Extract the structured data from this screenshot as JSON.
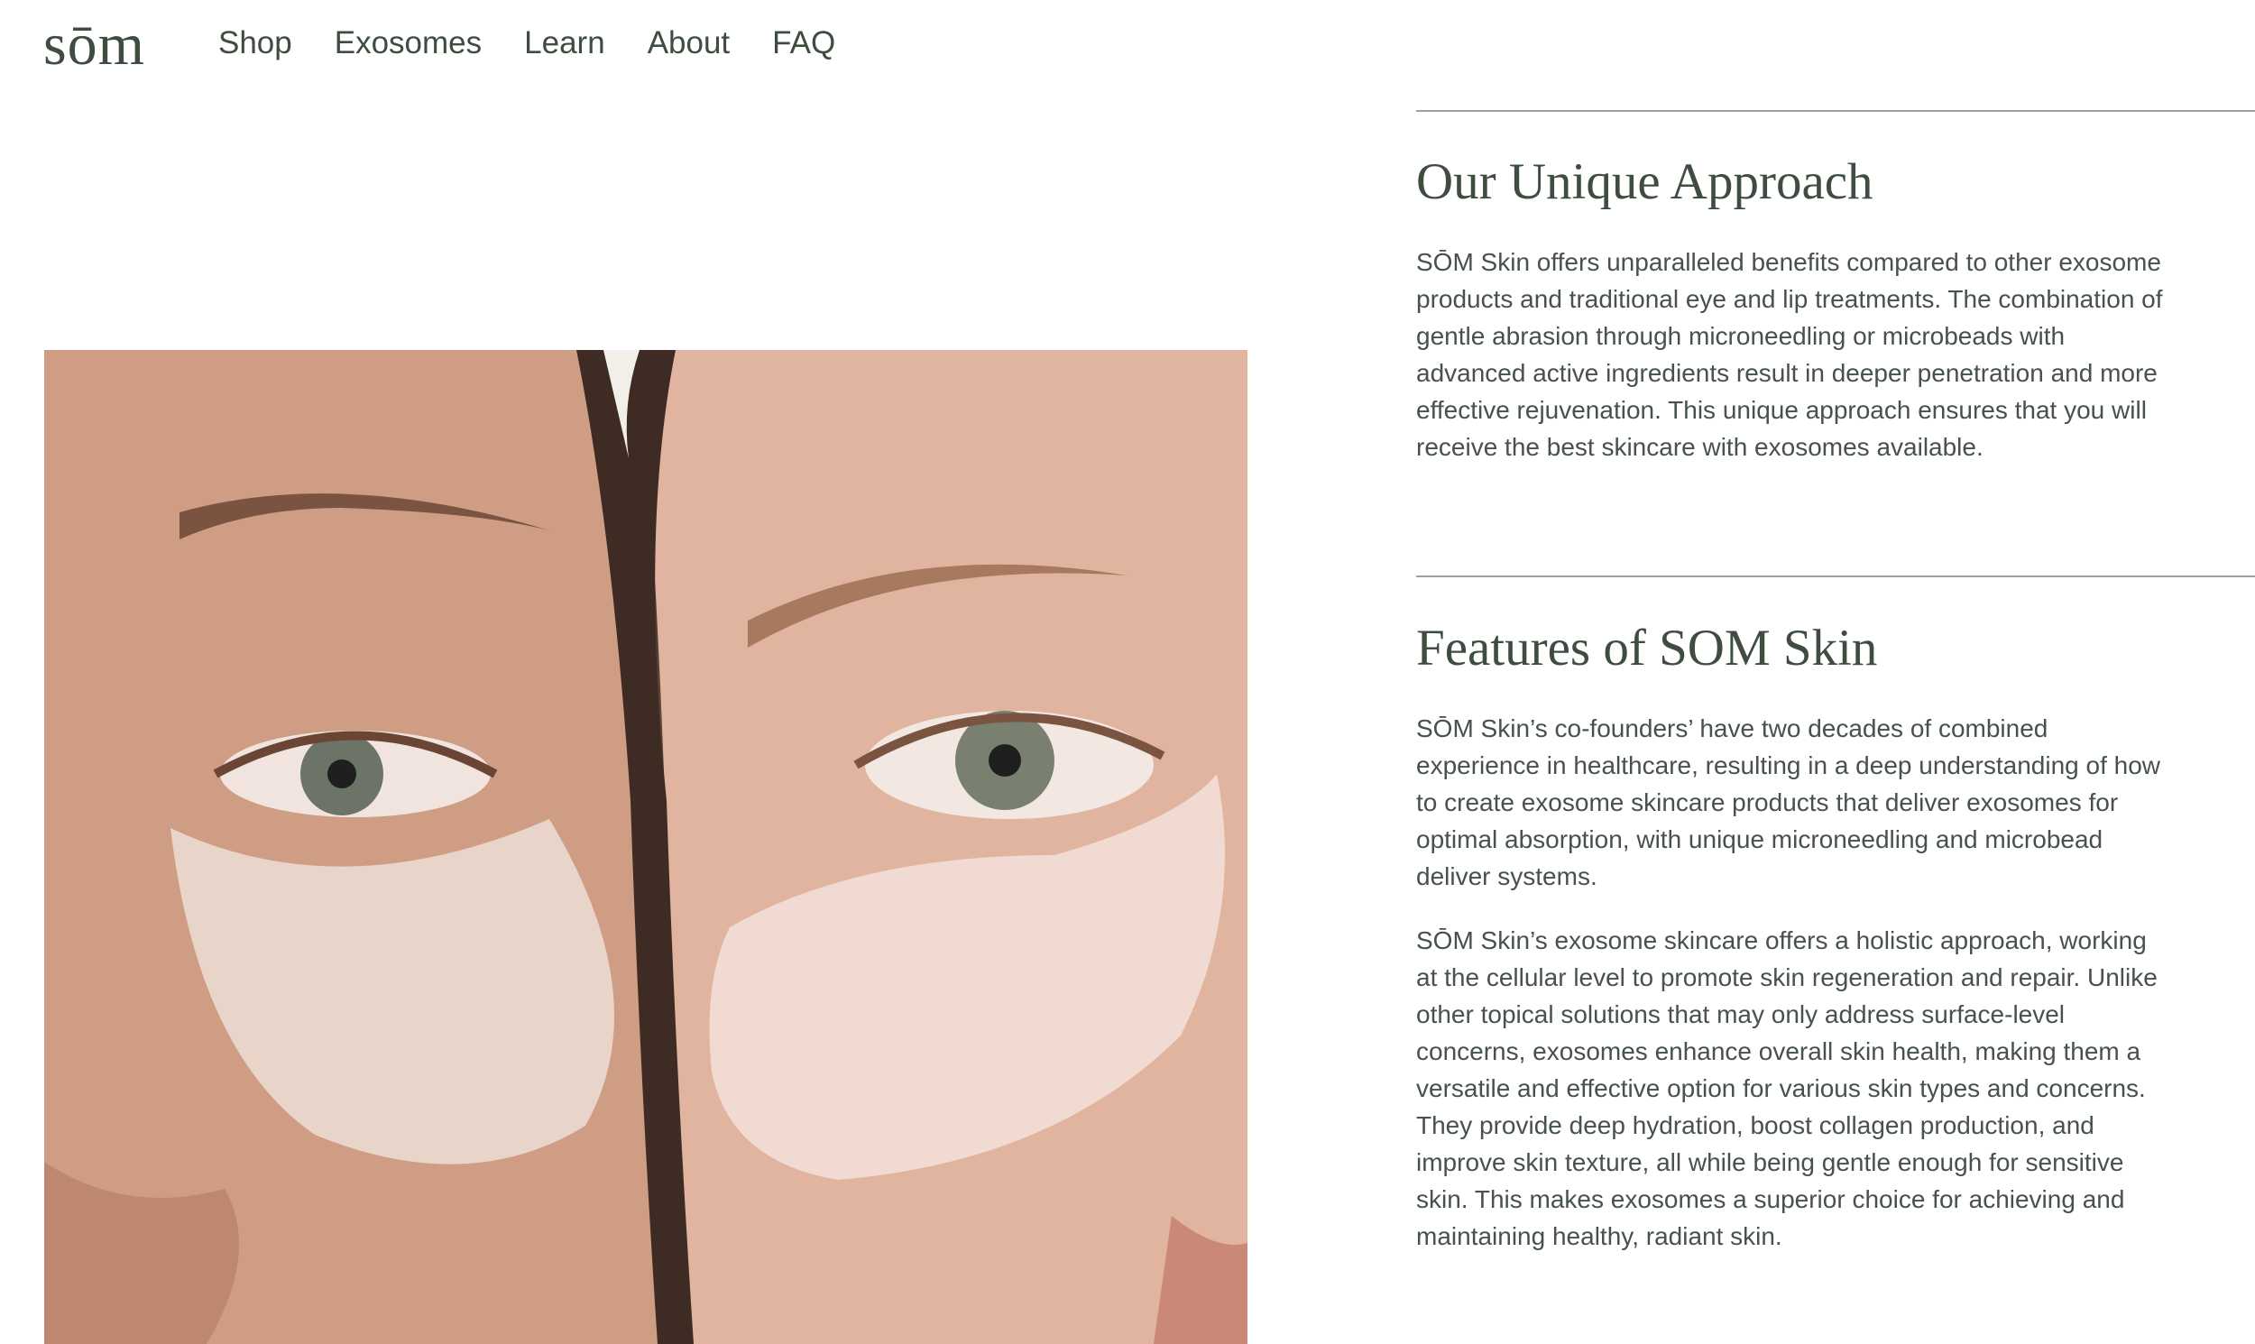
{
  "header": {
    "logo": "sōm",
    "nav": [
      {
        "label": "Shop"
      },
      {
        "label": "Exosomes"
      },
      {
        "label": "Learn"
      },
      {
        "label": "About"
      },
      {
        "label": "FAQ"
      }
    ]
  },
  "image": {
    "alt": ""
  },
  "approach": {
    "title": "Our Unique Approach",
    "body": "SŌM Skin offers unparalleled benefits compared to other exosome products and traditional eye and lip treatments. The combination of gentle abrasion through microneedling or microbeads with advanced active ingredients result in deeper penetration and more effective rejuvenation. This unique approach ensures that you will receive the best skincare with exosomes available."
  },
  "features": {
    "title": "Features of SOM Skin",
    "body1": "SŌM Skin’s co-founders’ have two decades of combined experience in healthcare, resulting in a deep understanding of how to create exosome skincare products that deliver exosomes for optimal absorption, with unique microneedling and microbead deliver systems.",
    "body2": "SŌM Skin’s exosome skincare offers a holistic approach, working at the cellular level to promote skin regeneration and repair. Unlike other topical solutions that may only address surface-level concerns, exosomes enhance overall skin health, making them a versatile and effective option for various skin types and concerns. They provide deep hydration, boost collagen production, and improve skin texture, all while being gentle enough for sensitive skin. This makes exosomes a superior choice for achieving and maintaining healthy, radiant skin."
  },
  "colors": {
    "text": "#3e4d3f",
    "rule": "#9aa29b"
  }
}
